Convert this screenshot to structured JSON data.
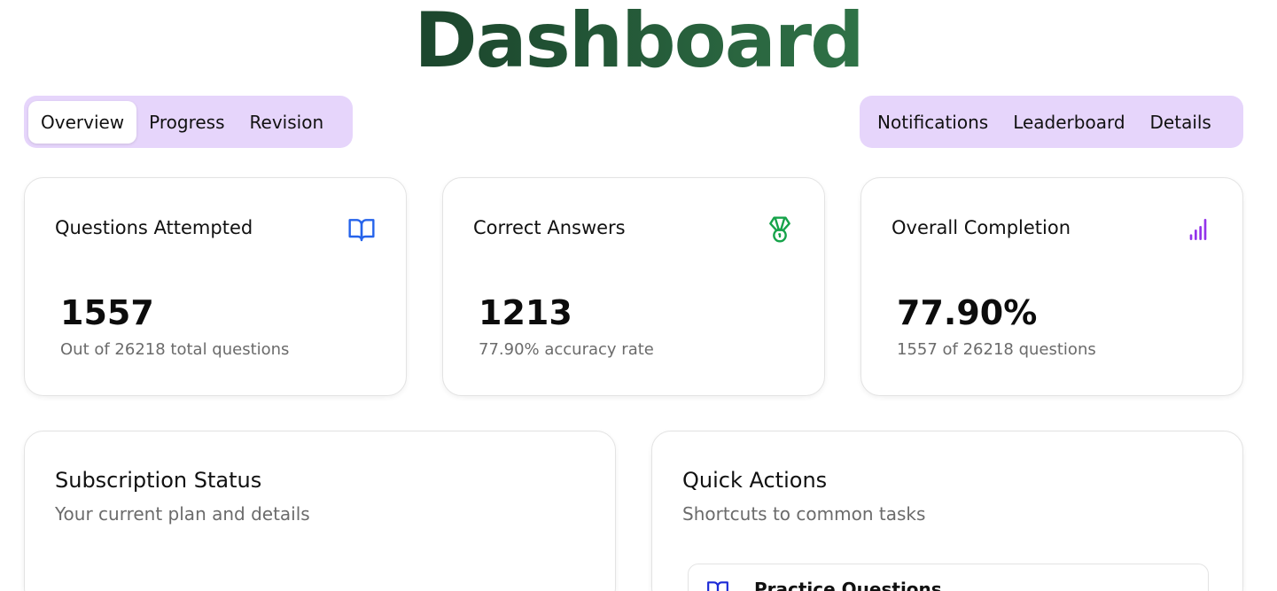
{
  "header": {
    "title": "Dashboard"
  },
  "tabs_left": [
    {
      "label": "Overview",
      "active": true
    },
    {
      "label": "Progress",
      "active": false
    },
    {
      "label": "Revision",
      "active": false
    }
  ],
  "tabs_right": [
    {
      "label": "Notifications"
    },
    {
      "label": "Leaderboard"
    },
    {
      "label": "Details"
    }
  ],
  "stats": [
    {
      "label": "Questions Attempted",
      "value": "1557",
      "sub": "Out of 26218 total questions",
      "icon": "book-open-icon",
      "icon_color": "#2563eb"
    },
    {
      "label": "Correct Answers",
      "value": "1213",
      "sub": "77.90% accuracy rate",
      "icon": "medal-icon",
      "icon_color": "#16a34a"
    },
    {
      "label": "Overall Completion",
      "value": "77.90%",
      "sub": "1557 of 26218 questions",
      "icon": "bar-chart-icon",
      "icon_color": "#9333ea"
    }
  ],
  "subscription": {
    "title": "Subscription Status",
    "description": "Your current plan and details"
  },
  "quick_actions": {
    "title": "Quick Actions",
    "description": "Shortcuts to common tasks",
    "items": [
      {
        "label": "Practice Questions",
        "icon": "book-open-icon",
        "icon_color": "#1d2bd6"
      }
    ]
  },
  "colors": {
    "tab_bg": "#e6d5fb",
    "title_gradient_start": "#0f2a1c",
    "title_gradient_end": "#4a9e64"
  }
}
